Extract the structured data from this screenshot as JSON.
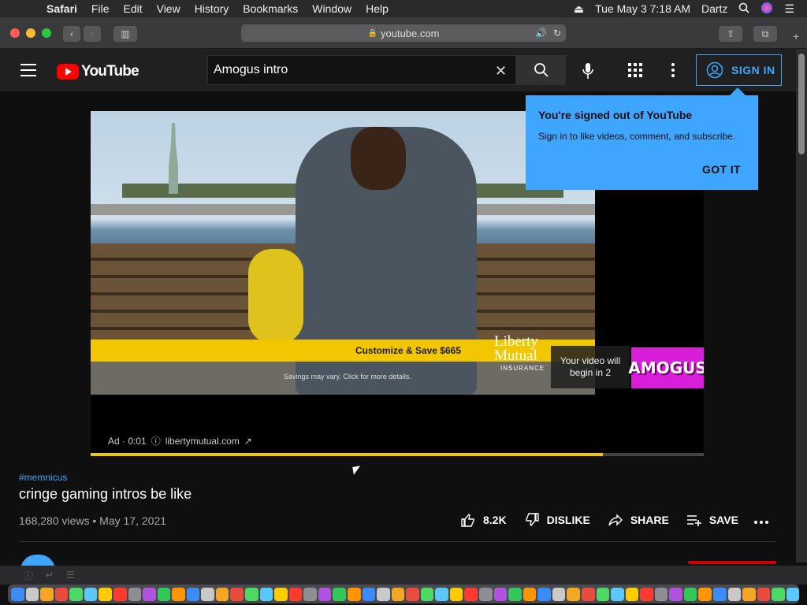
{
  "menubar": {
    "app": "Safari",
    "items": [
      "File",
      "Edit",
      "View",
      "History",
      "Bookmarks",
      "Window",
      "Help"
    ],
    "clock": "Tue May 3  7:18 AM",
    "user": "Dartz"
  },
  "browser": {
    "url": "youtube.com"
  },
  "header": {
    "logo_text": "YouTube",
    "search_value": "Amogus intro",
    "sign_in_label": "SIGN IN"
  },
  "popup": {
    "title": "You're signed out of YouTube",
    "subtitle": "Sign in to like videos, comment, and subscribe.",
    "dismiss_label": "GOT IT"
  },
  "ad": {
    "banner_text": "Customize & Save $665",
    "brand_line1": "Liberty",
    "brand_line2": "Mutual",
    "brand_line3": "INSURANCE",
    "fine_print": "Savings may vary. Click for more details.",
    "countdown_text": "Your video will begin in 2",
    "preview_title": "AMOGUS",
    "label": "Ad · 0:01",
    "advertiser_link": "libertymutual.com",
    "progress": 0.836
  },
  "video": {
    "hashtag": "#memnicus",
    "title": "cringe gaming intros be like",
    "meta": "168,280 views • May 17, 2021",
    "likes": "8.2K",
    "dislike_label": "DISLIKE",
    "share_label": "SHARE",
    "save_label": "SAVE"
  },
  "colors": {
    "accent": "#3ea6ff",
    "youtube_red": "#ff0000",
    "ad_yellow": "#f2c700",
    "background": "#0f0f0f"
  }
}
